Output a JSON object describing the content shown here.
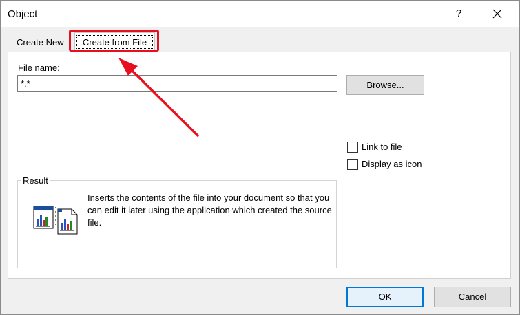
{
  "window": {
    "title": "Object",
    "help_label": "?"
  },
  "tabs": [
    {
      "label": "Create New"
    },
    {
      "label": "Create from File"
    }
  ],
  "form": {
    "file_name_label": "File name:",
    "file_name_value": "*.*",
    "browse_label": "Browse...",
    "link_to_file_label": "Link to file",
    "link_to_file_checked": false,
    "display_as_icon_label": "Display as icon",
    "display_as_icon_checked": false
  },
  "result": {
    "legend": "Result",
    "text": "Inserts the contents of the file into your document so that you can edit it later using the application which created the source file."
  },
  "buttons": {
    "ok_label": "OK",
    "cancel_label": "Cancel"
  },
  "colors": {
    "highlight": "#e8101e",
    "accent": "#0078d7",
    "dialog_bg": "#f0f0f0"
  },
  "icons": {
    "close": "close-icon",
    "result": "embed-document-icon"
  }
}
